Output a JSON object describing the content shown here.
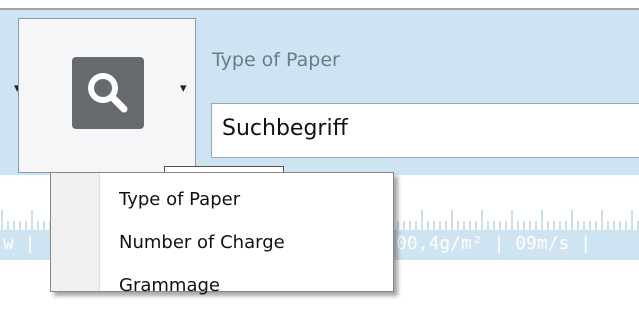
{
  "toolbar": {
    "search_icon": "search-icon",
    "dropdown_caret": "▾",
    "field_label": "Type of Paper",
    "search_value": "Suchbegriff"
  },
  "status_bar": {
    "left_text": "w |",
    "right_text": "00,4g/m² | 09m/s |"
  },
  "menu": {
    "items": [
      {
        "label": "Type of Paper"
      },
      {
        "label": "Number of Charge"
      },
      {
        "label": "Grammage"
      }
    ]
  },
  "colors": {
    "toolbar_bg": "#cfe4f2",
    "icon_tile": "#666a6e",
    "label_text": "#6b7b87"
  }
}
